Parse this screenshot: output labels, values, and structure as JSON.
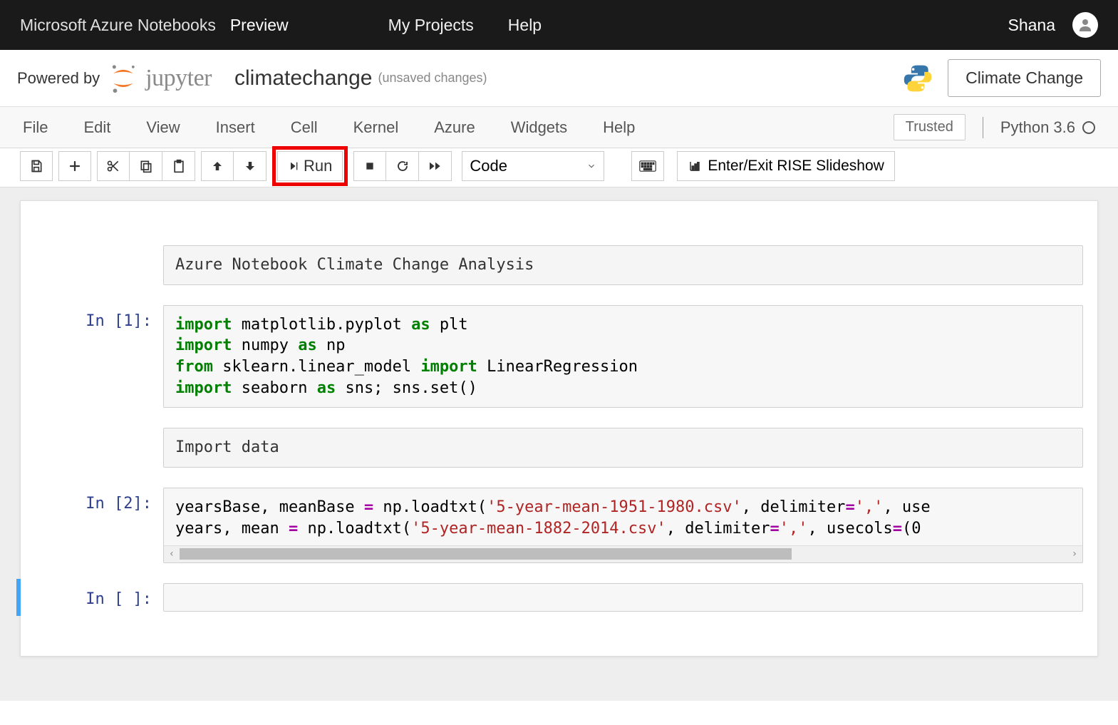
{
  "azure": {
    "brand": "Microsoft Azure Notebooks",
    "preview": "Preview",
    "nav": [
      "My Projects",
      "Help"
    ],
    "user": "Shana"
  },
  "header": {
    "powered": "Powered by",
    "jupyter": "jupyter",
    "notebook_name": "climatechange",
    "status": "(unsaved changes)",
    "project_button": "Climate Change"
  },
  "menubar": {
    "items": [
      "File",
      "Edit",
      "View",
      "Insert",
      "Cell",
      "Kernel",
      "Azure",
      "Widgets",
      "Help"
    ],
    "trusted": "Trusted",
    "kernel": "Python 3.6"
  },
  "toolbar": {
    "run_label": "Run",
    "cell_type": "Code",
    "rise": "Enter/Exit RISE Slideshow"
  },
  "cells": [
    {
      "type": "raw",
      "prompt": "",
      "text": "Azure Notebook Climate Change Analysis"
    },
    {
      "type": "code",
      "prompt": "In [1]:",
      "lines": [
        [
          [
            "kw",
            "import"
          ],
          [
            "black",
            " matplotlib.pyplot "
          ],
          [
            "kw",
            "as"
          ],
          [
            "black",
            " plt"
          ]
        ],
        [
          [
            "kw",
            "import"
          ],
          [
            "black",
            " numpy "
          ],
          [
            "kw",
            "as"
          ],
          [
            "black",
            " np"
          ]
        ],
        [
          [
            "kw",
            "from"
          ],
          [
            "black",
            " sklearn.linear_model "
          ],
          [
            "kw",
            "import"
          ],
          [
            "black",
            " LinearRegression"
          ]
        ],
        [
          [
            "kw",
            "import"
          ],
          [
            "black",
            " seaborn "
          ],
          [
            "kw",
            "as"
          ],
          [
            "black",
            " sns; sns.set()"
          ]
        ]
      ]
    },
    {
      "type": "raw",
      "prompt": "",
      "text": "Import data"
    },
    {
      "type": "code",
      "prompt": "In [2]:",
      "scroll": true,
      "lines": [
        [
          [
            "black",
            "yearsBase, meanBase "
          ],
          [
            "op",
            "="
          ],
          [
            "black",
            " np.loadtxt("
          ],
          [
            "str",
            "'5-year-mean-1951-1980.csv'"
          ],
          [
            "black",
            ", delimiter"
          ],
          [
            "op",
            "="
          ],
          [
            "str",
            "','"
          ],
          [
            "black",
            ", use"
          ]
        ],
        [
          [
            "black",
            "years, mean "
          ],
          [
            "op",
            "="
          ],
          [
            "black",
            " np.loadtxt("
          ],
          [
            "str",
            "'5-year-mean-1882-2014.csv'"
          ],
          [
            "black",
            ", delimiter"
          ],
          [
            "op",
            "="
          ],
          [
            "str",
            "','"
          ],
          [
            "black",
            ", usecols"
          ],
          [
            "op",
            "="
          ],
          [
            "black",
            "(0"
          ]
        ]
      ]
    },
    {
      "type": "code",
      "prompt": "In [ ]:",
      "empty": true,
      "selected": true
    }
  ]
}
